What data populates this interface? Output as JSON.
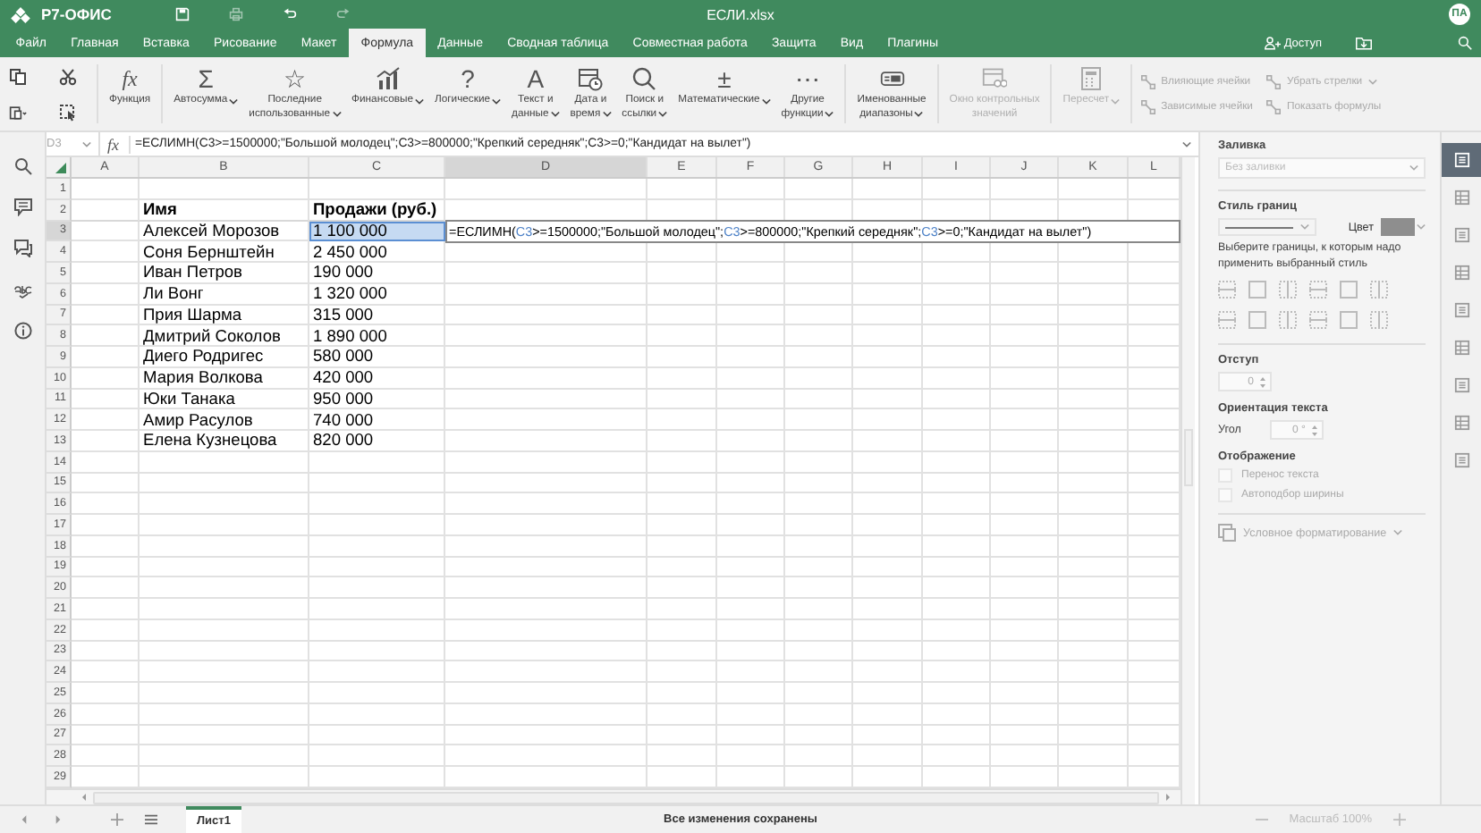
{
  "app": {
    "logo": "Р7-ОФИС",
    "title": "ЕСЛИ.xlsx",
    "avatar": "ПА"
  },
  "menu_tabs": [
    {
      "label": "Файл",
      "selected": false
    },
    {
      "label": "Главная",
      "selected": false
    },
    {
      "label": "Вставка",
      "selected": false
    },
    {
      "label": "Рисование",
      "selected": false
    },
    {
      "label": "Макет",
      "selected": false
    },
    {
      "label": "Формула",
      "selected": true
    },
    {
      "label": "Данные",
      "selected": false
    },
    {
      "label": "Сводная таблица",
      "selected": false
    },
    {
      "label": "Совместная работа",
      "selected": false
    },
    {
      "label": "Защита",
      "selected": false
    },
    {
      "label": "Вид",
      "selected": false
    },
    {
      "label": "Плагины",
      "selected": false
    }
  ],
  "access": {
    "label": "Доступ"
  },
  "toolbar": {
    "functions": [
      {
        "kind": "glyph",
        "glyph": "fx",
        "lines": [
          "Функция"
        ],
        "has_menu": false,
        "disabled": false
      },
      {
        "kind": "glyph",
        "glyph": "Σ",
        "lines": [
          "Автосумма"
        ],
        "has_menu": true,
        "disabled": false
      },
      {
        "kind": "glyph",
        "glyph": "☆",
        "lines": [
          "Последние",
          "использованные"
        ],
        "has_menu": true,
        "disabled": false
      },
      {
        "kind": "chart",
        "lines": [
          "Финансовые"
        ],
        "has_menu": true,
        "disabled": false
      },
      {
        "kind": "glyph",
        "glyph": "?",
        "lines": [
          "Логические"
        ],
        "has_menu": true,
        "disabled": false
      },
      {
        "kind": "glyph",
        "glyph": "A",
        "lines": [
          "Текст и",
          "данные"
        ],
        "has_menu": true,
        "disabled": false
      },
      {
        "kind": "calendar",
        "lines": [
          "Дата и",
          "время"
        ],
        "has_menu": true,
        "disabled": false
      },
      {
        "kind": "magnifier",
        "lines": [
          "Поиск и",
          "ссылки"
        ],
        "has_menu": true,
        "disabled": false
      },
      {
        "kind": "glyph",
        "glyph": "±",
        "lines": [
          "Математические"
        ],
        "has_menu": true,
        "disabled": false
      },
      {
        "kind": "glyph",
        "glyph": "⋯",
        "lines": [
          "Другие",
          "функции"
        ],
        "has_menu": true,
        "disabled": false
      },
      {
        "kind": "tag",
        "lines": [
          "Именованные",
          "диапазоны"
        ],
        "has_menu": true,
        "disabled": false
      },
      {
        "kind": "window",
        "lines": [
          "Окно контрольных",
          "значений"
        ],
        "has_menu": false,
        "disabled": true
      },
      {
        "kind": "calculator",
        "lines": [
          "Пересчет"
        ],
        "has_menu": true,
        "disabled": true
      }
    ],
    "trace": [
      {
        "label": "Влияющие ячейки",
        "has_menu": false,
        "disabled": true
      },
      {
        "label": "Убрать стрелки",
        "has_menu": true,
        "disabled": true
      },
      {
        "label": "Зависимые ячейки",
        "has_menu": false,
        "disabled": true
      },
      {
        "label": "Показать формулы",
        "has_menu": false,
        "disabled": true
      }
    ]
  },
  "formula_bar": {
    "cell": "D3",
    "fx": "fx",
    "formula": "=ЕСЛИМН(C3>=1500000;\"Большой молодец\";C3>=800000;\"Крепкий середняк\";C3>=0;\"Кандидат на вылет\")"
  },
  "sheet": {
    "columns": [
      {
        "label": "A",
        "selected": false
      },
      {
        "label": "B",
        "selected": false
      },
      {
        "label": "C",
        "selected": false
      },
      {
        "label": "D",
        "selected": true
      },
      {
        "label": "E",
        "selected": false
      },
      {
        "label": "F",
        "selected": false
      },
      {
        "label": "G",
        "selected": false
      },
      {
        "label": "H",
        "selected": false
      },
      {
        "label": "I",
        "selected": false
      },
      {
        "label": "J",
        "selected": false
      },
      {
        "label": "K",
        "selected": false
      },
      {
        "label": "L",
        "selected": false
      }
    ],
    "rows": [
      {
        "number": "1",
        "kind": "data",
        "selected": false
      },
      {
        "number": "2",
        "kind": "header",
        "name": "Имя",
        "sales": "Продажи (руб.)",
        "sales_selected": false,
        "selected": false
      },
      {
        "number": "3",
        "kind": "data",
        "name": "Алексей Морозов",
        "sales": "1 100 000",
        "sales_selected": true,
        "selected": true
      },
      {
        "number": "4",
        "kind": "data",
        "name": "Соня Бернштейн",
        "sales": "2 450 000",
        "sales_selected": false,
        "selected": false
      },
      {
        "number": "5",
        "kind": "data",
        "name": "Иван Петров",
        "sales": "190 000",
        "sales_selected": false,
        "selected": false
      },
      {
        "number": "6",
        "kind": "data",
        "name": "Ли Вонг",
        "sales": "1 320 000",
        "sales_selected": false,
        "selected": false
      },
      {
        "number": "7",
        "kind": "data",
        "name": "Прия Шарма",
        "sales": "315 000",
        "sales_selected": false,
        "selected": false
      },
      {
        "number": "8",
        "kind": "data",
        "name": "Дмитрий Соколов",
        "sales": "1 890 000",
        "sales_selected": false,
        "selected": false
      },
      {
        "number": "9",
        "kind": "data",
        "name": "Диего Родригес",
        "sales": "580 000",
        "sales_selected": false,
        "selected": false
      },
      {
        "number": "10",
        "kind": "data",
        "name": "Мария Волкова",
        "sales": "420 000",
        "sales_selected": false,
        "selected": false
      },
      {
        "number": "11",
        "kind": "data",
        "name": "Юки Танака",
        "sales": "950 000",
        "sales_selected": false,
        "selected": false
      },
      {
        "number": "12",
        "kind": "data",
        "name": "Амир Расулов",
        "sales": "740 000",
        "sales_selected": false,
        "selected": false
      },
      {
        "number": "13",
        "kind": "data",
        "name": "Елена Кузнецова",
        "sales": "820 000",
        "sales_selected": false,
        "selected": false
      },
      {
        "number": "14",
        "kind": "data",
        "selected": false
      },
      {
        "number": "15",
        "kind": "data",
        "selected": false
      },
      {
        "number": "16",
        "kind": "data",
        "selected": false
      },
      {
        "number": "17",
        "kind": "data",
        "selected": false
      },
      {
        "number": "18",
        "kind": "data",
        "selected": false
      },
      {
        "number": "19",
        "kind": "data",
        "selected": false
      },
      {
        "number": "20",
        "kind": "data",
        "selected": false
      },
      {
        "number": "21",
        "kind": "data",
        "selected": false
      },
      {
        "number": "22",
        "kind": "data",
        "selected": false
      },
      {
        "number": "23",
        "kind": "data",
        "selected": false
      },
      {
        "number": "24",
        "kind": "data",
        "selected": false
      },
      {
        "number": "25",
        "kind": "data",
        "selected": false
      },
      {
        "number": "26",
        "kind": "data",
        "selected": false
      },
      {
        "number": "27",
        "kind": "data",
        "selected": false
      },
      {
        "number": "28",
        "kind": "data",
        "selected": false
      },
      {
        "number": "29",
        "kind": "data",
        "selected": false
      }
    ],
    "editor": {
      "segments": [
        {
          "kind": "text",
          "text": "=ЕСЛИМН("
        },
        {
          "kind": "ref",
          "text": "C3"
        },
        {
          "kind": "text",
          "text": ">=1500000;\"Большой молодец\";"
        },
        {
          "kind": "ref",
          "text": "C3"
        },
        {
          "kind": "text",
          "text": ">=800000;\"Крепкий середняк\";"
        },
        {
          "kind": "ref",
          "text": "C3"
        },
        {
          "kind": "text",
          "text": ">=0;\"Кандидат на вылет\")"
        }
      ]
    }
  },
  "format_panel": {
    "fill": {
      "title": "Заливка",
      "value": "Без заливки",
      "disabled": true
    },
    "borders": {
      "title": "Стиль границ",
      "color_label": "Цвет",
      "hint": "Выберите границы, к которым надо применить выбранный стиль"
    },
    "indent": {
      "title": "Отступ",
      "value": "0"
    },
    "orientation": {
      "title": "Ориентация текста",
      "angle_label": "Угол",
      "value": "0 °"
    },
    "display": {
      "title": "Отображение",
      "options": [
        {
          "label": "Перенос текста",
          "checked": false,
          "disabled": true
        },
        {
          "label": "Автоподбор ширины",
          "checked": false,
          "disabled": true
        }
      ]
    },
    "conditional": {
      "label": "Условное форматирование",
      "disabled": true
    }
  },
  "panel_tabs": [
    {
      "selected": true
    },
    {
      "selected": false
    },
    {
      "selected": false
    },
    {
      "selected": false
    },
    {
      "selected": false
    },
    {
      "selected": false
    },
    {
      "selected": false
    },
    {
      "selected": false
    },
    {
      "selected": false
    }
  ],
  "status_bar": {
    "sheets": [
      {
        "label": "Лист1",
        "selected": true
      }
    ],
    "message": "Все изменения сохранены",
    "zoom": "Масштаб 100%"
  }
}
